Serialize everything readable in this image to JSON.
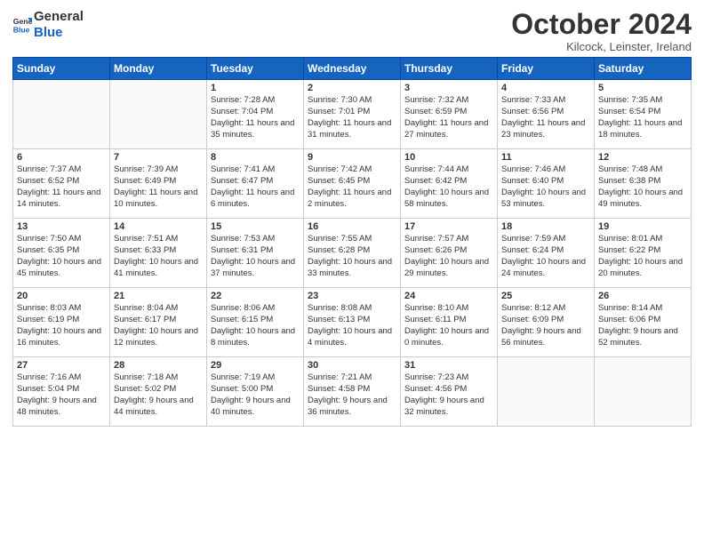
{
  "header": {
    "logo_general": "General",
    "logo_blue": "Blue",
    "month_title": "October 2024",
    "location": "Kilcock, Leinster, Ireland"
  },
  "weekdays": [
    "Sunday",
    "Monday",
    "Tuesday",
    "Wednesday",
    "Thursday",
    "Friday",
    "Saturday"
  ],
  "weeks": [
    [
      {
        "day": "",
        "info": ""
      },
      {
        "day": "",
        "info": ""
      },
      {
        "day": "1",
        "info": "Sunrise: 7:28 AM\nSunset: 7:04 PM\nDaylight: 11 hours and 35 minutes."
      },
      {
        "day": "2",
        "info": "Sunrise: 7:30 AM\nSunset: 7:01 PM\nDaylight: 11 hours and 31 minutes."
      },
      {
        "day": "3",
        "info": "Sunrise: 7:32 AM\nSunset: 6:59 PM\nDaylight: 11 hours and 27 minutes."
      },
      {
        "day": "4",
        "info": "Sunrise: 7:33 AM\nSunset: 6:56 PM\nDaylight: 11 hours and 23 minutes."
      },
      {
        "day": "5",
        "info": "Sunrise: 7:35 AM\nSunset: 6:54 PM\nDaylight: 11 hours and 18 minutes."
      }
    ],
    [
      {
        "day": "6",
        "info": "Sunrise: 7:37 AM\nSunset: 6:52 PM\nDaylight: 11 hours and 14 minutes."
      },
      {
        "day": "7",
        "info": "Sunrise: 7:39 AM\nSunset: 6:49 PM\nDaylight: 11 hours and 10 minutes."
      },
      {
        "day": "8",
        "info": "Sunrise: 7:41 AM\nSunset: 6:47 PM\nDaylight: 11 hours and 6 minutes."
      },
      {
        "day": "9",
        "info": "Sunrise: 7:42 AM\nSunset: 6:45 PM\nDaylight: 11 hours and 2 minutes."
      },
      {
        "day": "10",
        "info": "Sunrise: 7:44 AM\nSunset: 6:42 PM\nDaylight: 10 hours and 58 minutes."
      },
      {
        "day": "11",
        "info": "Sunrise: 7:46 AM\nSunset: 6:40 PM\nDaylight: 10 hours and 53 minutes."
      },
      {
        "day": "12",
        "info": "Sunrise: 7:48 AM\nSunset: 6:38 PM\nDaylight: 10 hours and 49 minutes."
      }
    ],
    [
      {
        "day": "13",
        "info": "Sunrise: 7:50 AM\nSunset: 6:35 PM\nDaylight: 10 hours and 45 minutes."
      },
      {
        "day": "14",
        "info": "Sunrise: 7:51 AM\nSunset: 6:33 PM\nDaylight: 10 hours and 41 minutes."
      },
      {
        "day": "15",
        "info": "Sunrise: 7:53 AM\nSunset: 6:31 PM\nDaylight: 10 hours and 37 minutes."
      },
      {
        "day": "16",
        "info": "Sunrise: 7:55 AM\nSunset: 6:28 PM\nDaylight: 10 hours and 33 minutes."
      },
      {
        "day": "17",
        "info": "Sunrise: 7:57 AM\nSunset: 6:26 PM\nDaylight: 10 hours and 29 minutes."
      },
      {
        "day": "18",
        "info": "Sunrise: 7:59 AM\nSunset: 6:24 PM\nDaylight: 10 hours and 24 minutes."
      },
      {
        "day": "19",
        "info": "Sunrise: 8:01 AM\nSunset: 6:22 PM\nDaylight: 10 hours and 20 minutes."
      }
    ],
    [
      {
        "day": "20",
        "info": "Sunrise: 8:03 AM\nSunset: 6:19 PM\nDaylight: 10 hours and 16 minutes."
      },
      {
        "day": "21",
        "info": "Sunrise: 8:04 AM\nSunset: 6:17 PM\nDaylight: 10 hours and 12 minutes."
      },
      {
        "day": "22",
        "info": "Sunrise: 8:06 AM\nSunset: 6:15 PM\nDaylight: 10 hours and 8 minutes."
      },
      {
        "day": "23",
        "info": "Sunrise: 8:08 AM\nSunset: 6:13 PM\nDaylight: 10 hours and 4 minutes."
      },
      {
        "day": "24",
        "info": "Sunrise: 8:10 AM\nSunset: 6:11 PM\nDaylight: 10 hours and 0 minutes."
      },
      {
        "day": "25",
        "info": "Sunrise: 8:12 AM\nSunset: 6:09 PM\nDaylight: 9 hours and 56 minutes."
      },
      {
        "day": "26",
        "info": "Sunrise: 8:14 AM\nSunset: 6:06 PM\nDaylight: 9 hours and 52 minutes."
      }
    ],
    [
      {
        "day": "27",
        "info": "Sunrise: 7:16 AM\nSunset: 5:04 PM\nDaylight: 9 hours and 48 minutes."
      },
      {
        "day": "28",
        "info": "Sunrise: 7:18 AM\nSunset: 5:02 PM\nDaylight: 9 hours and 44 minutes."
      },
      {
        "day": "29",
        "info": "Sunrise: 7:19 AM\nSunset: 5:00 PM\nDaylight: 9 hours and 40 minutes."
      },
      {
        "day": "30",
        "info": "Sunrise: 7:21 AM\nSunset: 4:58 PM\nDaylight: 9 hours and 36 minutes."
      },
      {
        "day": "31",
        "info": "Sunrise: 7:23 AM\nSunset: 4:56 PM\nDaylight: 9 hours and 32 minutes."
      },
      {
        "day": "",
        "info": ""
      },
      {
        "day": "",
        "info": ""
      }
    ]
  ]
}
